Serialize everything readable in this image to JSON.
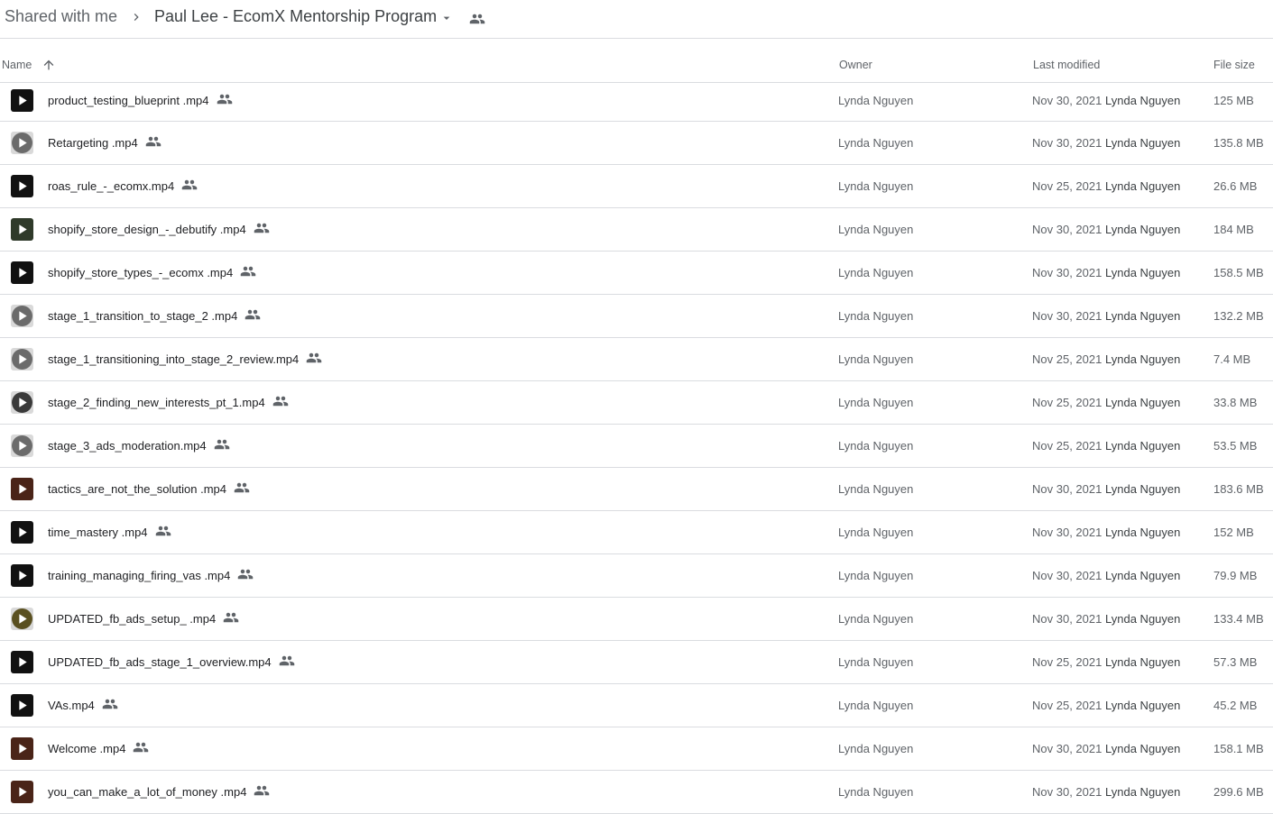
{
  "breadcrumb": {
    "parent": "Shared with me",
    "current": "Paul Lee - EcomX Mentorship Program"
  },
  "columns": {
    "name": "Name",
    "owner": "Owner",
    "last_modified": "Last modified",
    "file_size": "File size"
  },
  "colors": {
    "text_primary": "#202124",
    "text_secondary": "#5f6368",
    "divider": "#dadce0"
  },
  "icons": {
    "breadcrumb_separator": "chevron-right-icon",
    "folder_menu": "arrow-drop-down-icon",
    "shared": "people-icon",
    "sort": "arrow-upward-icon",
    "file": "video-play-icon"
  },
  "files": [
    {
      "name": "product_testing_blueprint .mp4",
      "owner": "Lynda Nguyen",
      "modified_date": "Nov 30, 2021",
      "modified_by": "Lynda Nguyen",
      "size": "125 MB",
      "thumb": "dark"
    },
    {
      "name": "Retargeting .mp4",
      "owner": "Lynda Nguyen",
      "modified_date": "Nov 30, 2021",
      "modified_by": "Lynda Nguyen",
      "size": "135.8 MB",
      "thumb": "grey"
    },
    {
      "name": "roas_rule_-_ecomx.mp4",
      "owner": "Lynda Nguyen",
      "modified_date": "Nov 25, 2021",
      "modified_by": "Lynda Nguyen",
      "size": "26.6 MB",
      "thumb": "dark"
    },
    {
      "name": "shopify_store_design_-_debutify .mp4",
      "owner": "Lynda Nguyen",
      "modified_date": "Nov 30, 2021",
      "modified_by": "Lynda Nguyen",
      "size": "184 MB",
      "thumb": "green"
    },
    {
      "name": "shopify_store_types_-_ecomx .mp4",
      "owner": "Lynda Nguyen",
      "modified_date": "Nov 30, 2021",
      "modified_by": "Lynda Nguyen",
      "size": "158.5 MB",
      "thumb": "dark"
    },
    {
      "name": "stage_1_transition_to_stage_2 .mp4",
      "owner": "Lynda Nguyen",
      "modified_date": "Nov 30, 2021",
      "modified_by": "Lynda Nguyen",
      "size": "132.2 MB",
      "thumb": "grey"
    },
    {
      "name": "stage_1_transitioning_into_stage_2_review.mp4",
      "owner": "Lynda Nguyen",
      "modified_date": "Nov 25, 2021",
      "modified_by": "Lynda Nguyen",
      "size": "7.4 MB",
      "thumb": "grey"
    },
    {
      "name": "stage_2_finding_new_interests_pt_1.mp4",
      "owner": "Lynda Nguyen",
      "modified_date": "Nov 25, 2021",
      "modified_by": "Lynda Nguyen",
      "size": "33.8 MB",
      "thumb": "photo"
    },
    {
      "name": "stage_3_ads_moderation.mp4",
      "owner": "Lynda Nguyen",
      "modified_date": "Nov 25, 2021",
      "modified_by": "Lynda Nguyen",
      "size": "53.5 MB",
      "thumb": "grey"
    },
    {
      "name": "tactics_are_not_the_solution .mp4",
      "owner": "Lynda Nguyen",
      "modified_date": "Nov 30, 2021",
      "modified_by": "Lynda Nguyen",
      "size": "183.6 MB",
      "thumb": "warm"
    },
    {
      "name": "time_mastery .mp4",
      "owner": "Lynda Nguyen",
      "modified_date": "Nov 30, 2021",
      "modified_by": "Lynda Nguyen",
      "size": "152 MB",
      "thumb": "dark"
    },
    {
      "name": "training_managing_firing_vas .mp4",
      "owner": "Lynda Nguyen",
      "modified_date": "Nov 30, 2021",
      "modified_by": "Lynda Nguyen",
      "size": "79.9 MB",
      "thumb": "dark"
    },
    {
      "name": "UPDATED_fb_ads_setup_ .mp4",
      "owner": "Lynda Nguyen",
      "modified_date": "Nov 30, 2021",
      "modified_by": "Lynda Nguyen",
      "size": "133.4 MB",
      "thumb": "olive"
    },
    {
      "name": "UPDATED_fb_ads_stage_1_overview.mp4",
      "owner": "Lynda Nguyen",
      "modified_date": "Nov 25, 2021",
      "modified_by": "Lynda Nguyen",
      "size": "57.3 MB",
      "thumb": "dark"
    },
    {
      "name": "VAs.mp4",
      "owner": "Lynda Nguyen",
      "modified_date": "Nov 25, 2021",
      "modified_by": "Lynda Nguyen",
      "size": "45.2 MB",
      "thumb": "dark"
    },
    {
      "name": "Welcome .mp4",
      "owner": "Lynda Nguyen",
      "modified_date": "Nov 30, 2021",
      "modified_by": "Lynda Nguyen",
      "size": "158.1 MB",
      "thumb": "warm"
    },
    {
      "name": "you_can_make_a_lot_of_money .mp4",
      "owner": "Lynda Nguyen",
      "modified_date": "Nov 30, 2021",
      "modified_by": "Lynda Nguyen",
      "size": "299.6 MB",
      "thumb": "warm"
    }
  ]
}
